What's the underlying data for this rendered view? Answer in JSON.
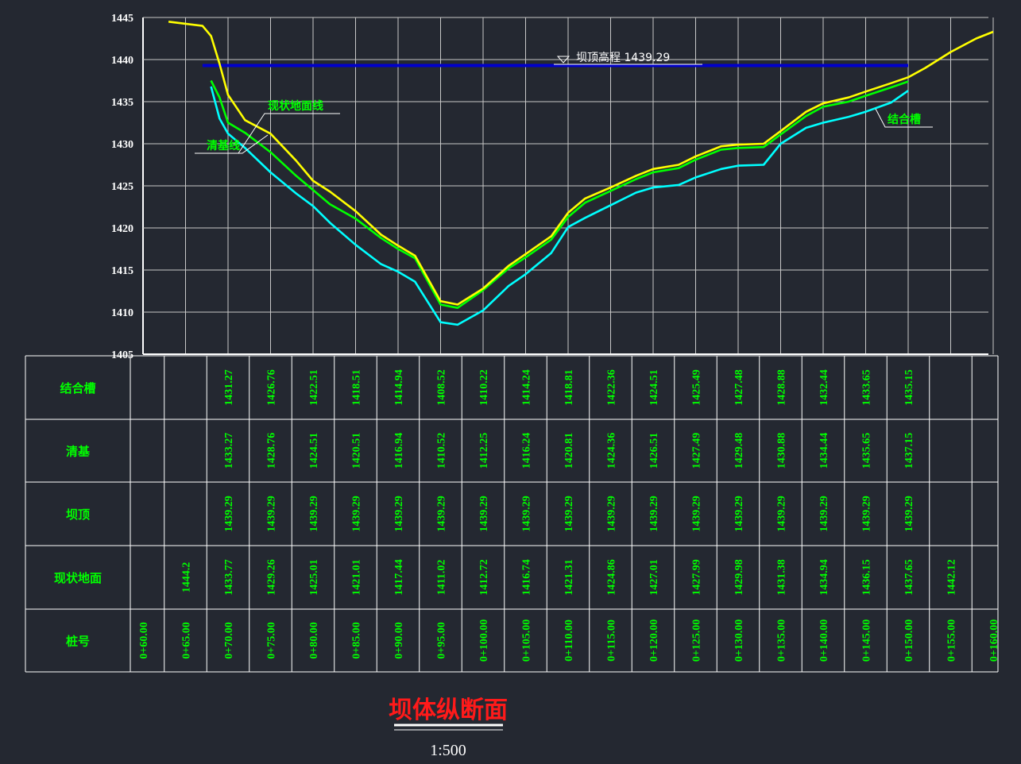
{
  "title": "坝体纵断面",
  "scale": "1:500",
  "chart_data": {
    "type": "line",
    "y_ticks": [
      "1445",
      "1440",
      "1435",
      "1430",
      "1425",
      "1420",
      "1415",
      "1410",
      "1405"
    ],
    "ylim": [
      1405,
      1445
    ],
    "xlim": [
      60,
      160
    ],
    "crest": {
      "label": "坝顶高程 1439.29",
      "value": 1439.29,
      "x_range": [
        67,
        150
      ],
      "color": "#0000cc"
    },
    "series": [
      {
        "key": "ground",
        "name": "现状地面线",
        "color": "#ffff00",
        "x": [
          63,
          67,
          68,
          69,
          70,
          72,
          75,
          78,
          80,
          82,
          85,
          88,
          90,
          92,
          95,
          97,
          100,
          103,
          105,
          108,
          110,
          112,
          115,
          118,
          120,
          123,
          125,
          128,
          130,
          133,
          135,
          138,
          140,
          143,
          145,
          148,
          150,
          152,
          155,
          158,
          160
        ],
        "y": [
          1444.5,
          1444.0,
          1442.8,
          1439.5,
          1435.8,
          1432.8,
          1431.2,
          1428.0,
          1425.6,
          1424.3,
          1422.0,
          1419.2,
          1417.9,
          1416.7,
          1411.3,
          1410.9,
          1412.8,
          1415.5,
          1416.9,
          1419.0,
          1421.8,
          1423.5,
          1424.8,
          1426.2,
          1427.0,
          1427.5,
          1428.5,
          1429.7,
          1429.9,
          1430.0,
          1431.5,
          1433.8,
          1434.8,
          1435.5,
          1436.2,
          1437.2,
          1437.9,
          1439.0,
          1440.9,
          1442.5,
          1443.3
        ]
      },
      {
        "key": "foundation",
        "name": "清基线",
        "color": "#00ff00",
        "x": [
          68,
          69,
          70,
          72,
          75,
          78,
          80,
          82,
          85,
          88,
          90,
          92,
          95,
          97,
          100,
          103,
          105,
          108,
          110,
          112,
          115,
          118,
          120,
          123,
          125,
          128,
          130,
          133,
          135,
          138,
          140,
          143,
          145,
          148,
          150
        ],
        "y": [
          1437.5,
          1435.5,
          1432.5,
          1431.3,
          1429.0,
          1426.2,
          1424.5,
          1422.8,
          1421.1,
          1418.8,
          1417.5,
          1416.4,
          1410.9,
          1410.5,
          1412.6,
          1415.2,
          1416.5,
          1418.6,
          1421.3,
          1423.0,
          1424.4,
          1425.8,
          1426.6,
          1427.1,
          1428.1,
          1429.3,
          1429.5,
          1429.6,
          1431.1,
          1433.3,
          1434.4,
          1435.0,
          1435.7,
          1436.7,
          1437.4
        ]
      },
      {
        "key": "trench",
        "name": "结合槽",
        "color": "#00ffff",
        "x": [
          68,
          69,
          70,
          72,
          75,
          78,
          80,
          82,
          85,
          88,
          90,
          92,
          95,
          97,
          100,
          103,
          105,
          108,
          110,
          112,
          115,
          118,
          120,
          123,
          125,
          128,
          130,
          133,
          135,
          138,
          140,
          143,
          145,
          148,
          150
        ],
        "y": [
          1436.8,
          1433.0,
          1431.2,
          1429.5,
          1426.6,
          1424.1,
          1422.6,
          1420.6,
          1418.0,
          1415.7,
          1414.8,
          1413.6,
          1408.8,
          1408.5,
          1410.2,
          1413.1,
          1414.5,
          1417.0,
          1420.1,
          1421.2,
          1422.7,
          1424.2,
          1424.8,
          1425.1,
          1426.0,
          1427.0,
          1427.4,
          1427.5,
          1430.0,
          1431.9,
          1432.5,
          1433.2,
          1433.8,
          1434.9,
          1436.3
        ]
      }
    ],
    "annotations": {
      "ground": "现状地面线",
      "foundation": "清基线",
      "trench": "结合槽"
    }
  },
  "table": {
    "rows": [
      {
        "label": "结合槽",
        "values": [
          "",
          "",
          "1431.27",
          "1426.76",
          "1422.51",
          "1418.51",
          "1414.94",
          "1408.52",
          "1410.22",
          "1414.24",
          "1418.81",
          "1422.36",
          "1424.51",
          "1425.49",
          "1427.48",
          "1428.88",
          "1432.44",
          "1433.65",
          "1435.15",
          "",
          ""
        ]
      },
      {
        "label": "清基",
        "values": [
          "",
          "",
          "1433.27",
          "1428.76",
          "1424.51",
          "1420.51",
          "1416.94",
          "1410.52",
          "1412.25",
          "1416.24",
          "1420.81",
          "1424.36",
          "1426.51",
          "1427.49",
          "1429.48",
          "1430.88",
          "1434.44",
          "1435.65",
          "1437.15",
          "",
          ""
        ]
      },
      {
        "label": "坝顶",
        "values": [
          "",
          "",
          "1439.29",
          "1439.29",
          "1439.29",
          "1439.29",
          "1439.29",
          "1439.29",
          "1439.29",
          "1439.29",
          "1439.29",
          "1439.29",
          "1439.29",
          "1439.29",
          "1439.29",
          "1439.29",
          "1439.29",
          "1439.29",
          "1439.29",
          "",
          ""
        ]
      },
      {
        "label": "现状地面",
        "values": [
          "",
          "1444.2",
          "1433.77",
          "1429.26",
          "1425.01",
          "1421.01",
          "1417.44",
          "1411.02",
          "1412.72",
          "1416.74",
          "1421.31",
          "1424.86",
          "1427.01",
          "1427.99",
          "1429.98",
          "1431.38",
          "1434.94",
          "1436.15",
          "1437.65",
          "1442.12",
          ""
        ]
      },
      {
        "label": "桩号",
        "values": [
          "0+60.00",
          "0+65.00",
          "0+70.00",
          "0+75.00",
          "0+80.00",
          "0+85.00",
          "0+90.00",
          "0+95.00",
          "0+100.00",
          "0+105.00",
          "0+110.00",
          "0+115.00",
          "0+120.00",
          "0+125.00",
          "0+130.00",
          "0+135.00",
          "0+140.00",
          "0+145.00",
          "0+150.00",
          "0+155.00",
          "0+160.00"
        ]
      }
    ]
  }
}
